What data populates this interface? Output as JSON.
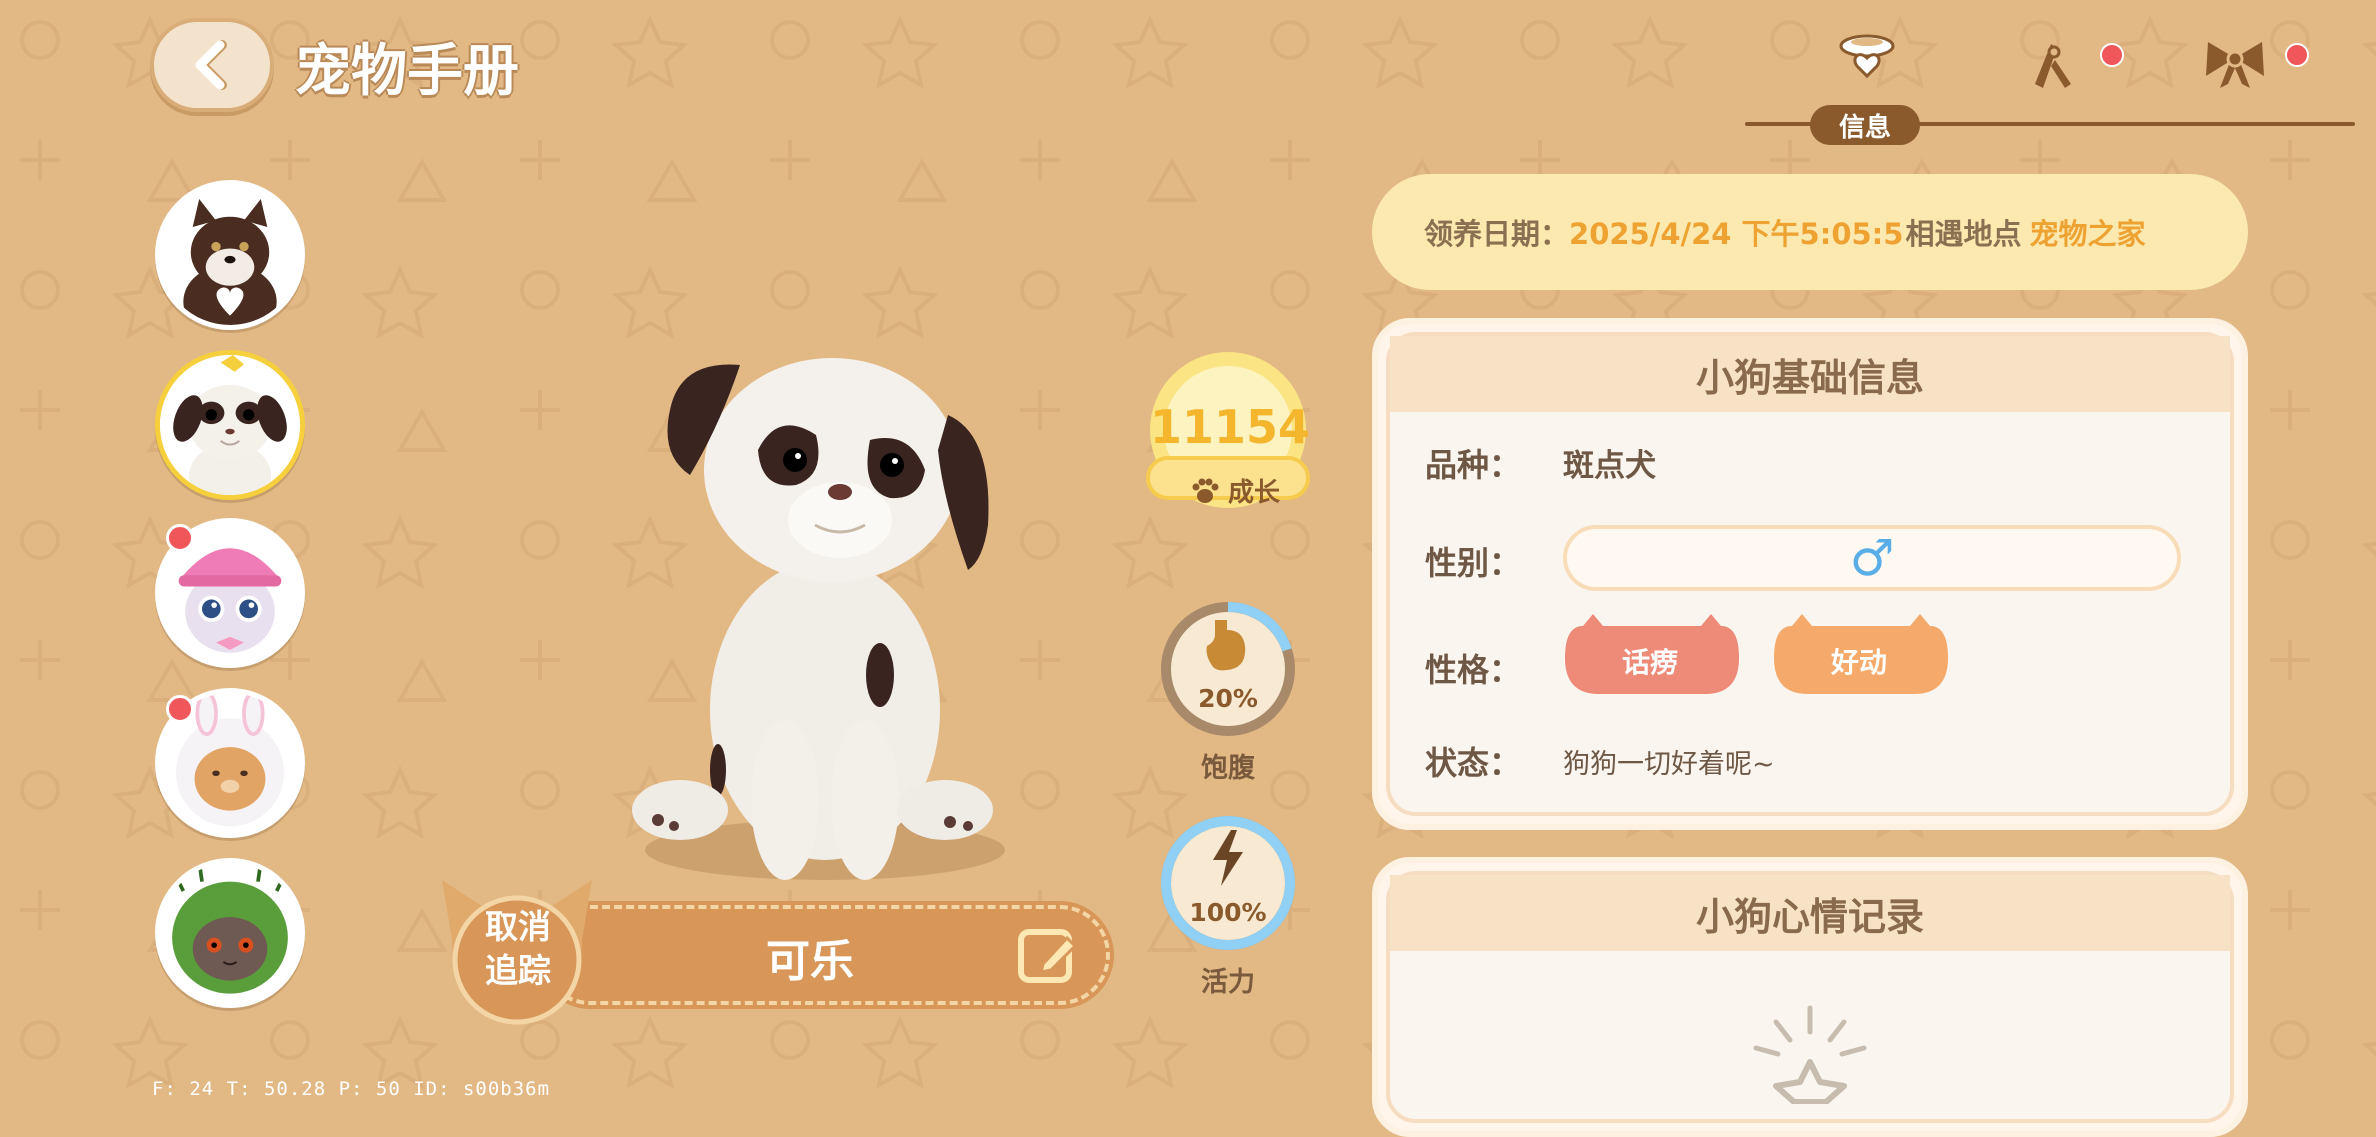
{
  "header": {
    "title": "宠物手册",
    "tabs": [
      {
        "icon": "collar-icon",
        "label": "信息",
        "active": true,
        "has_dot": false
      },
      {
        "icon": "grooming-tools-icon",
        "label": "",
        "active": false,
        "has_dot": true
      },
      {
        "icon": "bow-icon",
        "label": "",
        "active": false,
        "has_dot": true
      }
    ],
    "active_tab_label": "信息"
  },
  "pet_list": [
    {
      "name": "chocolate-puppy-avatar",
      "selected": false,
      "has_dot": false
    },
    {
      "name": "spotted-puppy-avatar",
      "selected": true,
      "has_dot": false
    },
    {
      "name": "mushroom-hat-cat-avatar",
      "selected": false,
      "has_dot": true
    },
    {
      "name": "bunny-hood-cat-avatar",
      "selected": false,
      "has_dot": true
    },
    {
      "name": "cactus-hood-cat-avatar",
      "selected": false,
      "has_dot": false
    }
  ],
  "pet": {
    "name": "可乐",
    "untrack_line1": "取消",
    "untrack_line2": "追踪"
  },
  "stats": {
    "growth_value": "11154",
    "growth_label": "成长",
    "hunger_percent": "20%",
    "hunger_fraction": 0.2,
    "hunger_label": "饱腹",
    "energy_percent": "100%",
    "energy_fraction": 1.0,
    "energy_label": "活力"
  },
  "adoption": {
    "date_label": "领养日期：",
    "date_value": "2025/4/24 下午5:05:5",
    "place_label": "相遇地点",
    "place_value": "宠物之家"
  },
  "basic_info": {
    "title": "小狗基础信息",
    "breed_label": "品种：",
    "breed_value": "斑点犬",
    "gender_label": "性别：",
    "gender_value": "♂",
    "personality_label": "性格：",
    "traits": [
      "话痨",
      "好动"
    ],
    "status_label": "状态：",
    "status_value": "狗狗一切好着呢~"
  },
  "mood_record": {
    "title": "小狗心情记录"
  },
  "debug": {
    "text": "F: 24    T: 50.28    P: 50    ID: s00b36m"
  },
  "colors": {
    "background": "#e2b985",
    "accent_yellow": "#f6cf3d",
    "dark_brown": "#8a5a2c",
    "tag_red": "#ee8a78",
    "tag_orange": "#f5aa6c",
    "energy_blue": "#8fd0f4"
  }
}
